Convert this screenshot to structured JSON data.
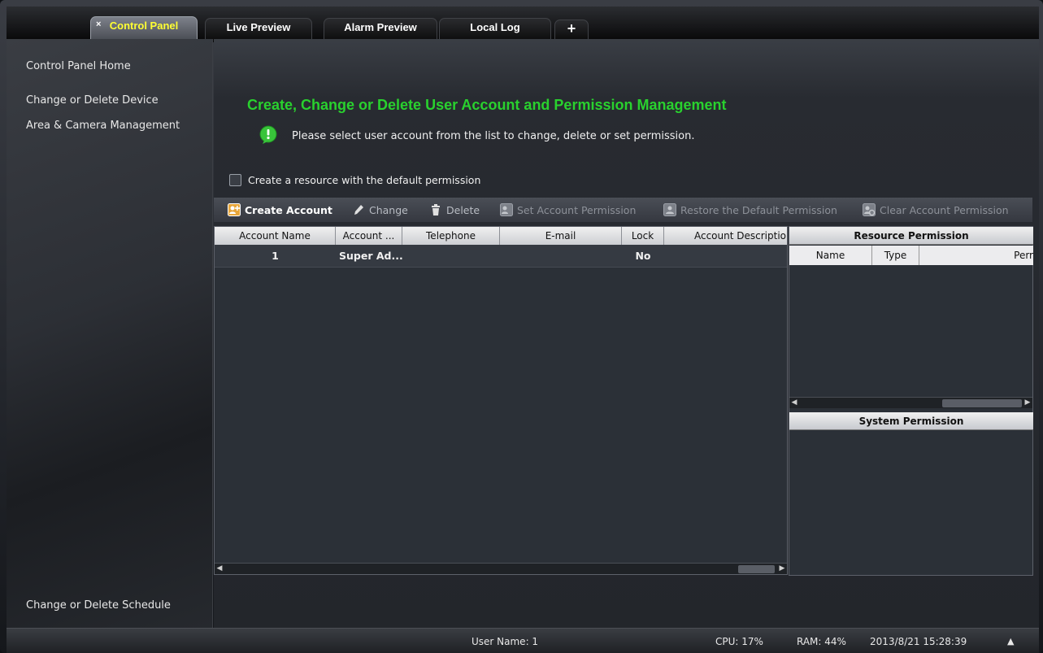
{
  "tabs": [
    {
      "label": "Control Panel",
      "active": true,
      "close_glyph": "×"
    },
    {
      "label": "Live Preview"
    },
    {
      "label": "Alarm Preview"
    },
    {
      "label": "Local Log"
    },
    {
      "label": "+"
    }
  ],
  "sidebar": {
    "items": [
      {
        "label": "Control Panel Home"
      },
      {
        "label": "Change or Delete Device"
      },
      {
        "label": "Area & Camera Management"
      },
      {
        "label": "Change or Delete Schedule"
      }
    ]
  },
  "main": {
    "heading": "Create, Change or Delete User Account and Permission Management",
    "info_icon": "info-bubble-icon",
    "info_text": "Please select user account from the list to change, delete or set permission.",
    "checkbox_label": "Create a resource with the default permission",
    "checkbox_checked": false
  },
  "toolbar": {
    "create": "Create Account",
    "change": "Change",
    "delete": "Delete",
    "set_permission": "Set Account Permission",
    "restore_default": "Restore the Default Permission",
    "clear_permission": "Clear Account Permission"
  },
  "accounts_table": {
    "columns": [
      "Account Name",
      "Account ...",
      "Telephone",
      "E-mail",
      "Lock",
      "Account Descriptio"
    ],
    "rows": [
      {
        "account_name": "1",
        "account_type": "Super Ad...",
        "telephone": "",
        "email": "",
        "lock": "No",
        "description": ""
      }
    ]
  },
  "resource_permission": {
    "title": "Resource Permission",
    "columns": [
      "Name",
      "Type",
      "Perr"
    ]
  },
  "system_permission": {
    "title": "System Permission"
  },
  "status_bar": {
    "user": "User Name: 1",
    "cpu": "CPU: 17%",
    "ram": "RAM: 44%",
    "datetime": "2013/8/21 15:28:39",
    "up_arrow": "▲"
  },
  "colors": {
    "heading": "#29d12e",
    "active_tab_text": "#ffff33"
  }
}
